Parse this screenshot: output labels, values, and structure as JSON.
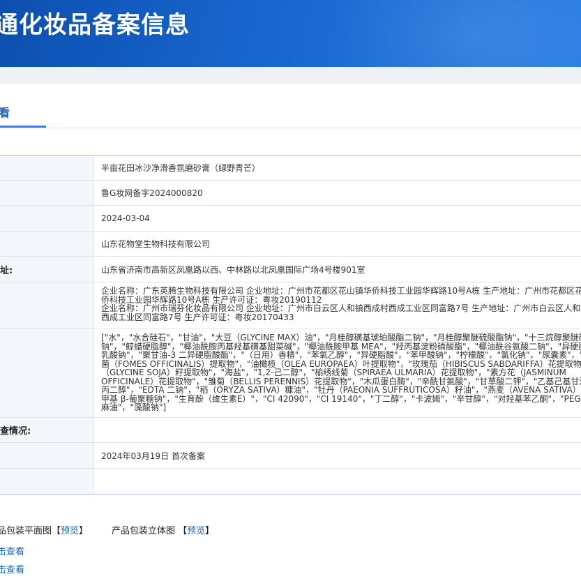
{
  "header": {
    "title": "通化妆品备案信息"
  },
  "tabs": [
    {
      "label": "看"
    }
  ],
  "rows": [
    {
      "label": "",
      "value": "半亩花田冰沙净滑香氛磨砂膏（绿野青芒）"
    },
    {
      "label": "",
      "value": "鲁G妆网备字2024000820"
    },
    {
      "label": "",
      "value": "2024-03-04"
    },
    {
      "label": "",
      "value": "山东花物堂生物科技有限公司"
    },
    {
      "label": "址:",
      "value": "山东省济南市高新区凤凰路以西、中林路以北凤凰国际广场4号楼901室"
    },
    {
      "label": "",
      "lines": [
        "企业名称：广东英腾生物科技有限公司 企业地址：广州市花都区花山镇华侨科技工业园华辉路10号A栋 生产地址：广州市花都区花",
        "侨科技工业园华辉路10号A栋 生产许可证：粤妆20190112",
        "企业名称：广州市瑞芬化妆品有限公司 企业地址：广州市白云区人和镇西成村西成工业区同富路7号 生产地址：广州市白云区人和镇",
        "西成工业区同富路7号 生产许可证：粤妆20170433"
      ]
    },
    {
      "label": "",
      "lines": [
        "[\"水\"，\"水合硅石\"，\"甘油\"，\"大豆（GLYCINE MAX）油\"，\"月桂醇磺基琥珀酸酯二钠\"，\"月桂醇聚醚硫酸酯钠\"，\"十三烷醇聚醚硫",
        "钠\"，\"鲸蜡硬脂醇\"，\"椰油酰胺丙基羟基磺基甜菜碱\"，\"椰油酰胺甲基 MEA\"，\"羟丙基淀粉磷酸酯\"，\"椰油酰谷氨酸二钠\"，\"异硬脂",
        "乳酸钠\"，\"聚甘油-3 二异硬脂酸酯\"，\"（日用）香精\"，\"苯氧乙醇\"，\"异硬脂酸\"，\"苯甲酸钠\"，\"柠檬酸\"，\"氯化钠\"，\"尿囊素\"，\"药",
        "菌（FOMES OFFICINALIS）提取物\"，\"油橄榄（OLEA EUROPAEA）叶提取物\"，\"玫瑰茄（HIBISCUS SABDARIFFA）花提取物\"，",
        "（GLYCINE SOJA）籽提取物\"，\"海盐\"，\"1,2-己二醇\"，\"榆绣线菊（SPIRAEA ULMARIA）花提取物\"，\"素方花（JASMINUM",
        "OFFICINALE）花提取物\"，\"雏菊（BELLIS PERENNIS）花提取物\"，\"木瓜蛋白酶\"，\"辛酰甘氨酸\"，\"甘草酸二钾\"，\"乙基己基甘油",
        "丙二醇\"，\"EDTA 二钠\"，\"稻（ORYZA SATIVA）糠油\"，\"牡丹（PAEONIA SUFFRUTICOSA）籽油\"，\"燕麦（AVENA SATIVA）仁",
        "甲基 β-葡聚糖钠\"，\"生育酚（维生素E）\"，\"CI 42090\"，\"CI 19140\"，\"丁二醇\"，\"卡波姆\"，\"辛甘醇\"，\"对羟基苯乙酮\"，\"PEG-40",
        "麻油\"，\"藻酸钠\"]"
      ]
    },
    {
      "label": "查情况:",
      "value": ""
    },
    {
      "label": "",
      "value": "2024年03月19日 首次备案"
    },
    {
      "label": "",
      "value": ""
    }
  ],
  "bottom": {
    "flat_label": "品包装平面图【",
    "flat_link": "预览",
    "flat_close": "】",
    "stereo_label": "产品包装立体图 【",
    "stereo_link": "预览",
    "stereo_close": "】",
    "click1": "击查看",
    "click2": "击查看"
  }
}
